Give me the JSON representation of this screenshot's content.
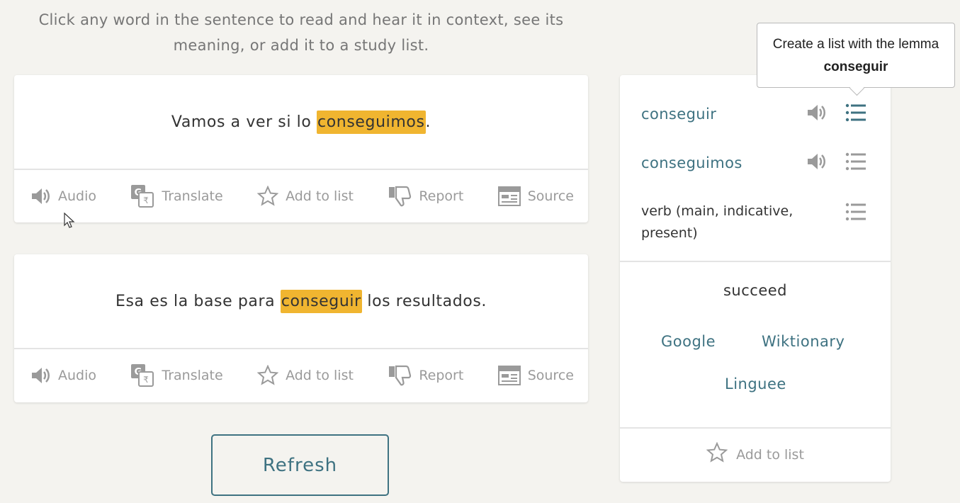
{
  "instructions": "Click any word in the sentence to read and hear it in context, see its meaning, or add it to a study list.",
  "sentences": [
    {
      "before": "Vamos a ver si lo ",
      "highlight": "conseguimos",
      "after": "."
    },
    {
      "before": "Esa es la base para ",
      "highlight": "conseguir",
      "after": " los resultados."
    }
  ],
  "actions": {
    "audio": "Audio",
    "translate": "Translate",
    "add_to_list": "Add to list",
    "report": "Report",
    "source": "Source"
  },
  "refresh_label": "Refresh",
  "panel": {
    "lemma": "conseguir",
    "form": "conseguimos",
    "pos": "verb (main, indicative, present)",
    "meaning": "succeed",
    "dictionaries": [
      "Google",
      "Wiktionary",
      "Linguee"
    ],
    "add_to_list": "Add to list"
  },
  "tooltip": {
    "text": "Create a list with the lemma",
    "bold": "conseguir"
  },
  "icons": {
    "audio": "speaker-icon",
    "translate": "translate-icon",
    "add_to_list": "star-icon",
    "report": "thumbs-down-icon",
    "source": "source-icon",
    "list": "list-icon"
  },
  "colors": {
    "highlight": "#f0b530",
    "link": "#3e7281",
    "muted": "#9a9a9a",
    "background": "#f4f3ef"
  }
}
